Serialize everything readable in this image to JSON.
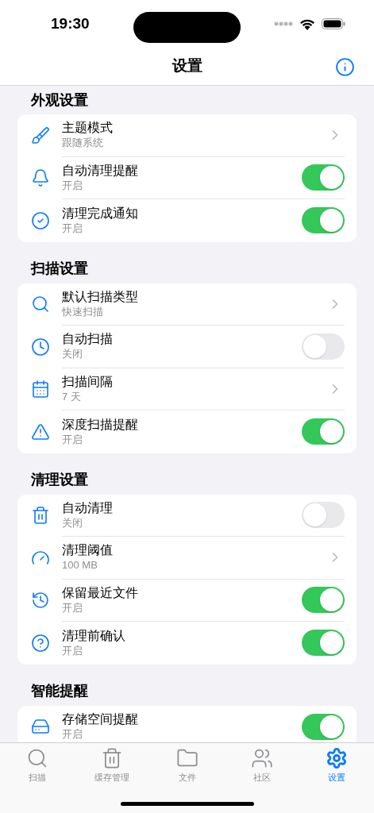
{
  "status_bar": {
    "time": "19:30"
  },
  "nav": {
    "title": "设置"
  },
  "sections": [
    {
      "title": "外观设置",
      "rows": [
        {
          "kind": "chevron",
          "label": "主题模式",
          "detail": "跟随系统"
        },
        {
          "kind": "toggle",
          "label": "自动清理提醒",
          "detail": "开启",
          "on": true
        },
        {
          "kind": "toggle",
          "label": "清理完成通知",
          "detail": "开启",
          "on": true
        }
      ]
    },
    {
      "title": "扫描设置",
      "rows": [
        {
          "kind": "chevron",
          "label": "默认扫描类型",
          "detail": "快速扫描"
        },
        {
          "kind": "toggle",
          "label": "自动扫描",
          "detail": "关闭",
          "on": false
        },
        {
          "kind": "chevron",
          "label": "扫描间隔",
          "detail": "7 天"
        },
        {
          "kind": "toggle",
          "label": "深度扫描提醒",
          "detail": "开启",
          "on": true
        }
      ]
    },
    {
      "title": "清理设置",
      "rows": [
        {
          "kind": "toggle",
          "label": "自动清理",
          "detail": "关闭",
          "on": false
        },
        {
          "kind": "chevron",
          "label": "清理阈值",
          "detail": "100 MB"
        },
        {
          "kind": "toggle",
          "label": "保留最近文件",
          "detail": "开启",
          "on": true
        },
        {
          "kind": "toggle",
          "label": "清理前确认",
          "detail": "开启",
          "on": true
        }
      ]
    },
    {
      "title": "智能提醒",
      "rows": [
        {
          "kind": "toggle",
          "label": "存储空间提醒",
          "detail": "开启",
          "on": true
        }
      ]
    }
  ],
  "tab_bar": [
    {
      "label": "扫描",
      "selected": false
    },
    {
      "label": "缓存管理",
      "selected": false
    },
    {
      "label": "文件",
      "selected": false
    },
    {
      "label": "社区",
      "selected": false
    },
    {
      "label": "设置",
      "selected": true
    }
  ]
}
